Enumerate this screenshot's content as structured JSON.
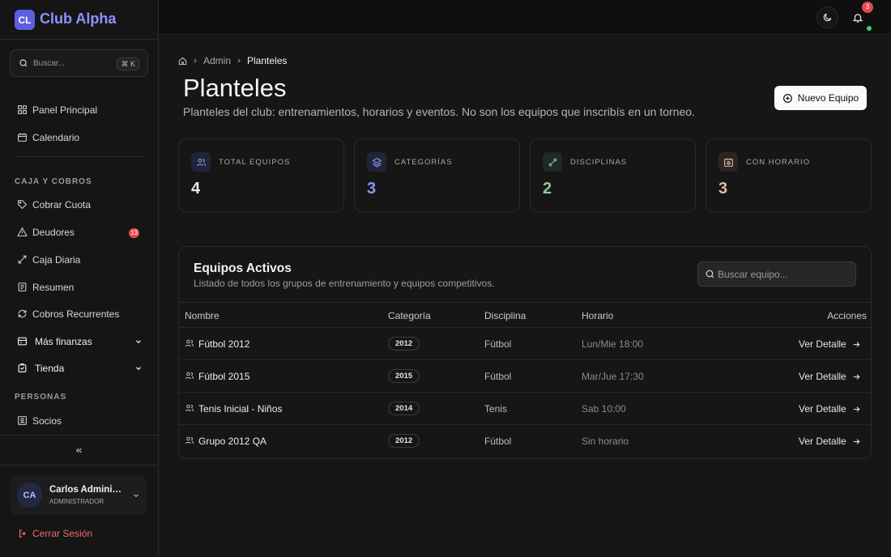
{
  "brand": {
    "logo_text": "CL",
    "name": "Club Alpha"
  },
  "sidebar": {
    "search": {
      "placeholder": "Buscar...",
      "shortcut": "⌘ K"
    },
    "items": [
      {
        "label": "Panel Principal",
        "icon": "dashboard-icon"
      },
      {
        "label": "Calendario",
        "icon": "calendar-icon"
      }
    ],
    "section_caja": "CAJA Y COBROS",
    "caja_items": [
      {
        "label": "Cobrar Cuota",
        "icon": "tag-icon"
      },
      {
        "label": "Deudores",
        "icon": "warning-icon",
        "badge": "13"
      },
      {
        "label": "Caja Diaria",
        "icon": "wallet-icon"
      },
      {
        "label": "Resumen",
        "icon": "report-icon"
      },
      {
        "label": "Cobros Recurrentes",
        "icon": "repeat-icon"
      }
    ],
    "groups": [
      {
        "label": "Más finanzas",
        "icon": "finance-icon"
      },
      {
        "label": "Tienda",
        "icon": "store-icon"
      }
    ],
    "section_personas": "PERSONAS",
    "personas_items": [
      {
        "label": "Socios",
        "icon": "members-icon"
      }
    ],
    "user": {
      "initials": "CA",
      "name": "Carlos Administrador",
      "role": "ADMINISTRADOR"
    },
    "logout": "Cerrar Sesión"
  },
  "topbar": {
    "notifications": "3"
  },
  "breadcrumb": [
    "Admin",
    "Planteles"
  ],
  "page": {
    "title": "Planteles",
    "subtitle": "Planteles del club: entrenamientos, horarios y eventos. No son los equipos que inscribís en un torneo.",
    "new_button": "Nuevo Equipo"
  },
  "stats": [
    {
      "label": "TOTAL EQUIPOS",
      "value": "4",
      "color": "#e8e8e8",
      "icon": "users-icon"
    },
    {
      "label": "CATEGORÍAS",
      "value": "3",
      "color": "#8f95ee",
      "icon": "layers-icon"
    },
    {
      "label": "DISCIPLINAS",
      "value": "2",
      "color": "#8cc9a0",
      "icon": "dumbbell-icon"
    },
    {
      "label": "CON HORARIO",
      "value": "3",
      "color": "#e3b8a8",
      "icon": "clock-calendar-icon"
    }
  ],
  "teams": {
    "title": "Equipos Activos",
    "subtitle": "Listado de todos los grupos de entrenamiento y equipos competitivos.",
    "search_placeholder": "Buscar equipo...",
    "columns": [
      "Nombre",
      "Categoría",
      "Disciplina",
      "Horario",
      "Acciones"
    ],
    "rows": [
      {
        "name": "Fútbol 2012",
        "category": "2012",
        "discipline": "Fútbol",
        "schedule": "Lun/Mie 18:00",
        "action": "Ver Detalle"
      },
      {
        "name": "Fútbol 2015",
        "category": "2015",
        "discipline": "Fútbol",
        "schedule": "Mar/Jue 17:30",
        "action": "Ver Detalle"
      },
      {
        "name": "Tenis Inicial - Niños",
        "category": "2014",
        "discipline": "Tenis",
        "schedule": "Sab 10:00",
        "action": "Ver Detalle"
      },
      {
        "name": "Grupo 2012 QA",
        "category": "2012",
        "discipline": "Fútbol",
        "schedule": "Sin horario",
        "action": "Ver Detalle"
      }
    ]
  }
}
